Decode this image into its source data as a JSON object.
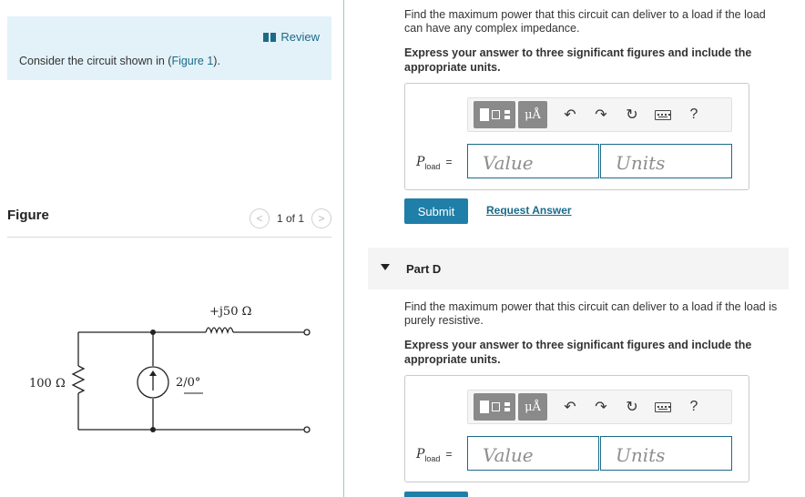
{
  "intro": {
    "review_label": "Review",
    "consider_prefix": "Consider the circuit shown in (",
    "figure_link": "Figure 1",
    "consider_suffix": ")."
  },
  "figure": {
    "title": "Figure",
    "pager_text": "1 of 1",
    "prev_symbol": "<",
    "next_symbol": ">",
    "circuit": {
      "reactance_label": "+j50 Ω",
      "resistor_label": "100 Ω",
      "source_label": "2/0°"
    }
  },
  "part_c": {
    "question": "Find the maximum power that this circuit can deliver to a load if the load can have any complex impedance.",
    "instruction": "Express your answer to three significant figures and include the appropriate units.",
    "answer_label_var": "P",
    "answer_label_sub": "load",
    "answer_label_eq": "=",
    "value_placeholder": "Value",
    "units_placeholder": "Units",
    "submit_label": "Submit",
    "request_label": "Request Answer"
  },
  "part_d": {
    "title": "Part D",
    "question": "Find the maximum power that this circuit can deliver to a load if the load is purely resistive.",
    "instruction": "Express your answer to three significant figures and include the appropriate units.",
    "answer_label_var": "P",
    "answer_label_sub": "load",
    "answer_label_eq": "=",
    "value_placeholder": "Value",
    "units_placeholder": "Units"
  },
  "toolbar": {
    "units_symbol": "μÅ",
    "undo_symbol": "↶",
    "redo_symbol": "↷",
    "reset_symbol": "↻",
    "help_symbol": "?"
  },
  "colors": {
    "accent": "#1f7fa8",
    "link": "#1a6b8a",
    "intro_bg": "#e3f2f8",
    "toolbar_button": "#8a8a8a"
  },
  "icons": [
    "book-icon",
    "chevron-left-icon",
    "chevron-right-icon",
    "templates-icon",
    "units-icon",
    "undo-icon",
    "redo-icon",
    "reset-icon",
    "keyboard-icon",
    "help-icon",
    "collapse-triangle-icon"
  ]
}
